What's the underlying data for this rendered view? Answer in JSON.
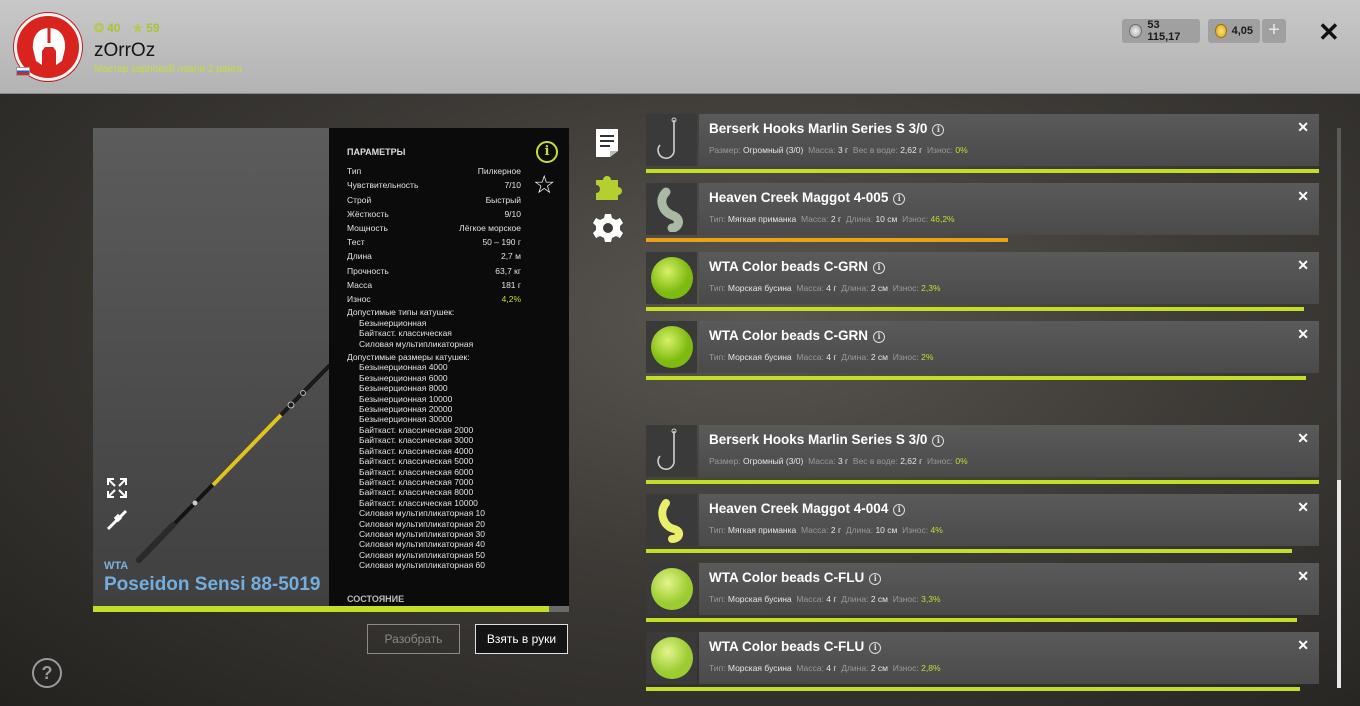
{
  "player": {
    "level_label": "40",
    "stars_label": "59",
    "nickname": "zOrrOz",
    "rank": "Мастер карповой ловли 2 ранга"
  },
  "wallet": {
    "silver": "53 115,17",
    "gold": "4,05"
  },
  "rod": {
    "brand": "WTA",
    "name": "Poseidon Sensi 88-5019",
    "durability_fraction": 0.958,
    "params_title": "ПАРАМЕТРЫ",
    "params": [
      {
        "label": "Тип",
        "value": "Пилкерное"
      },
      {
        "label": "Чувствительность",
        "value": "7/10"
      },
      {
        "label": "Строй",
        "value": "Быстрый"
      },
      {
        "label": "Жёсткость",
        "value": "9/10"
      },
      {
        "label": "Мощность",
        "value": "Лёгкое морское"
      },
      {
        "label": "Тест",
        "value": "50 – 190 г"
      },
      {
        "label": "Длина",
        "value": "2,7 м"
      },
      {
        "label": "Прочность",
        "value": "63,7 кг"
      },
      {
        "label": "Масса",
        "value": "181 г"
      },
      {
        "label": "Износ",
        "value": "4,2%"
      }
    ],
    "reel_types_title": "Допустимые типы катушек:",
    "reel_types": [
      "Безынерционная",
      "Байткаст. классическая",
      "Силовая мультипликаторная"
    ],
    "reel_sizes_title": "Допустимые размеры катушек:",
    "reel_sizes": [
      "Безынерционная 4000",
      "Безынерционная 6000",
      "Безынерционная 8000",
      "Безынерционная 10000",
      "Безынерционная 20000",
      "Безынерционная 30000",
      "Байткаст. классическая 2000",
      "Байткаст. классическая 3000",
      "Байткаст. классическая 4000",
      "Байткаст. классическая 5000",
      "Байткаст. классическая 6000",
      "Байткаст. классическая 7000",
      "Байткаст. классическая 8000",
      "Байткаст. классическая 10000",
      "Силовая мультипликаторная 10",
      "Силовая мультипликаторная 20",
      "Силовая мультипликаторная 30",
      "Силовая мультипликаторная 40",
      "Силовая мультипликаторная 50",
      "Силовая мультипликаторная 60"
    ],
    "state_title": "СОСТОЯНИЕ"
  },
  "buttons": {
    "disassemble": "Разобрать",
    "take": "Взять в руки"
  },
  "icons": {
    "info": "i",
    "star": "☆",
    "help": "?",
    "remove": "✕",
    "close": "✕",
    "plus": "+"
  },
  "tackle": [
    {
      "name": "Berserk Hooks Marlin Series S 3/0",
      "kind": "hook",
      "m1l": "Размер:",
      "m1v": "Огромный (3/0)",
      "m2l": "Масса:",
      "m2v": "3 г",
      "m3l": "Вес в воде:",
      "m3v": "2,62 г",
      "m4l": "Износ:",
      "m4v": "0%",
      "wear": 1.0,
      "orange": false
    },
    {
      "name": "Heaven Creek Maggot 4-005",
      "kind": "maggot-grey",
      "m1l": "Тип:",
      "m1v": "Мягкая приманка",
      "m2l": "Масса:",
      "m2v": "2 г",
      "m3l": "Длина:",
      "m3v": "10 см",
      "m4l": "Износ:",
      "m4v": "46,2%",
      "wear": 0.538,
      "orange": true
    },
    {
      "name": "WTA Color beads C-GRN",
      "kind": "bead-green",
      "m1l": "Тип:",
      "m1v": "Морская бусина",
      "m2l": "Масса:",
      "m2v": "4 г",
      "m3l": "Длина:",
      "m3v": "2 см",
      "m4l": "Износ:",
      "m4v": "2,3%",
      "wear": 0.977,
      "orange": false
    },
    {
      "name": "WTA Color beads C-GRN",
      "kind": "bead-green",
      "m1l": "Тип:",
      "m1v": "Морская бусина",
      "m2l": "Масса:",
      "m2v": "4 г",
      "m3l": "Длина:",
      "m3v": "2 см",
      "m4l": "Износ:",
      "m4v": "2%",
      "wear": 0.98,
      "orange": false
    },
    {
      "name": "Berserk Hooks Marlin Series S 3/0",
      "kind": "hook",
      "m1l": "Размер:",
      "m1v": "Огромный (3/0)",
      "m2l": "Масса:",
      "m2v": "3 г",
      "m3l": "Вес в воде:",
      "m3v": "2,62 г",
      "m4l": "Износ:",
      "m4v": "0%",
      "wear": 1.0,
      "orange": false
    },
    {
      "name": "Heaven Creek Maggot 4-004",
      "kind": "maggot-yellow",
      "m1l": "Тип:",
      "m1v": "Мягкая приманка",
      "m2l": "Масса:",
      "m2v": "2 г",
      "m3l": "Длина:",
      "m3v": "10 см",
      "m4l": "Износ:",
      "m4v": "4%",
      "wear": 0.96,
      "orange": false
    },
    {
      "name": "WTA Color beads C-FLU",
      "kind": "bead-flu",
      "m1l": "Тип:",
      "m1v": "Морская бусина",
      "m2l": "Масса:",
      "m2v": "4 г",
      "m3l": "Длина:",
      "m3v": "2 см",
      "m4l": "Износ:",
      "m4v": "3,3%",
      "wear": 0.967,
      "orange": false
    },
    {
      "name": "WTA Color beads C-FLU",
      "kind": "bead-flu",
      "m1l": "Тип:",
      "m1v": "Морская бусина",
      "m2l": "Масса:",
      "m2v": "4 г",
      "m3l": "Длина:",
      "m3v": "2 см",
      "m4l": "Износ:",
      "m4v": "2,8%",
      "wear": 0.972,
      "orange": false
    }
  ],
  "colors": {
    "accent_green": "#c3de27",
    "wear_orange": "#e8a21a",
    "rod_name_blue": "#74aede"
  }
}
